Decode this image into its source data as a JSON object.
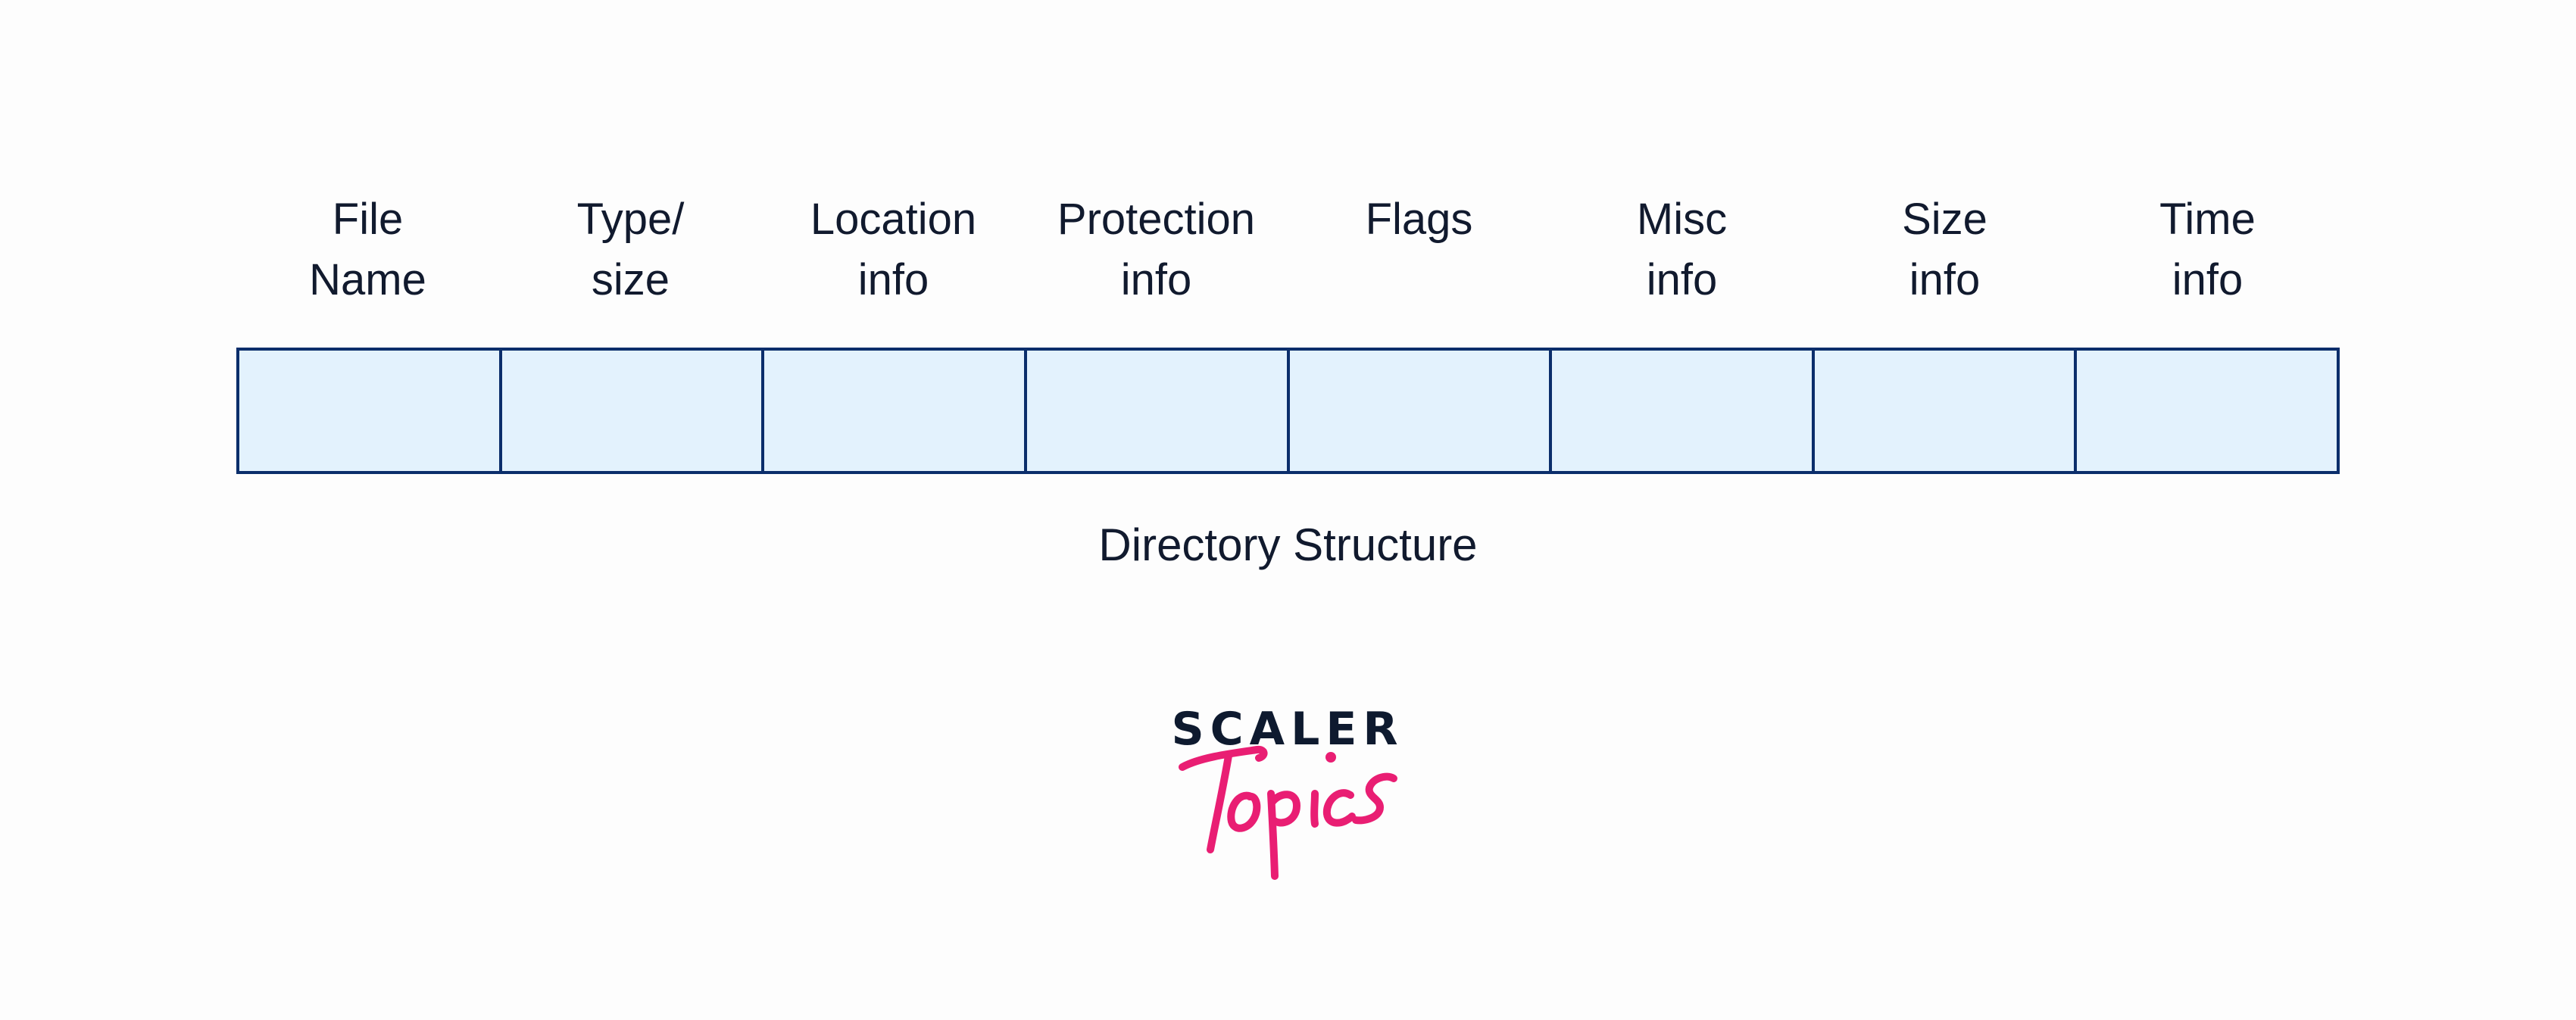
{
  "diagram": {
    "headers": [
      {
        "lines": [
          "File",
          "Name"
        ]
      },
      {
        "lines": [
          "Type/",
          "size"
        ]
      },
      {
        "lines": [
          "Location",
          "info"
        ]
      },
      {
        "lines": [
          "Protection",
          "info"
        ]
      },
      {
        "lines": [
          "Flags"
        ]
      },
      {
        "lines": [
          "Misc",
          "info"
        ]
      },
      {
        "lines": [
          "Size",
          "info"
        ]
      },
      {
        "lines": [
          "Time",
          "info"
        ]
      }
    ],
    "caption": "Directory Structure"
  },
  "logo": {
    "wordmark": "SCALER",
    "script": "Topics",
    "wordmark_color": "#0e1a2f",
    "script_color": "#e91e73"
  },
  "colors": {
    "cell_fill": "#e3f2fd",
    "cell_border": "#0b2e6b",
    "text": "#111a2e",
    "background": "#fdfdfd"
  }
}
